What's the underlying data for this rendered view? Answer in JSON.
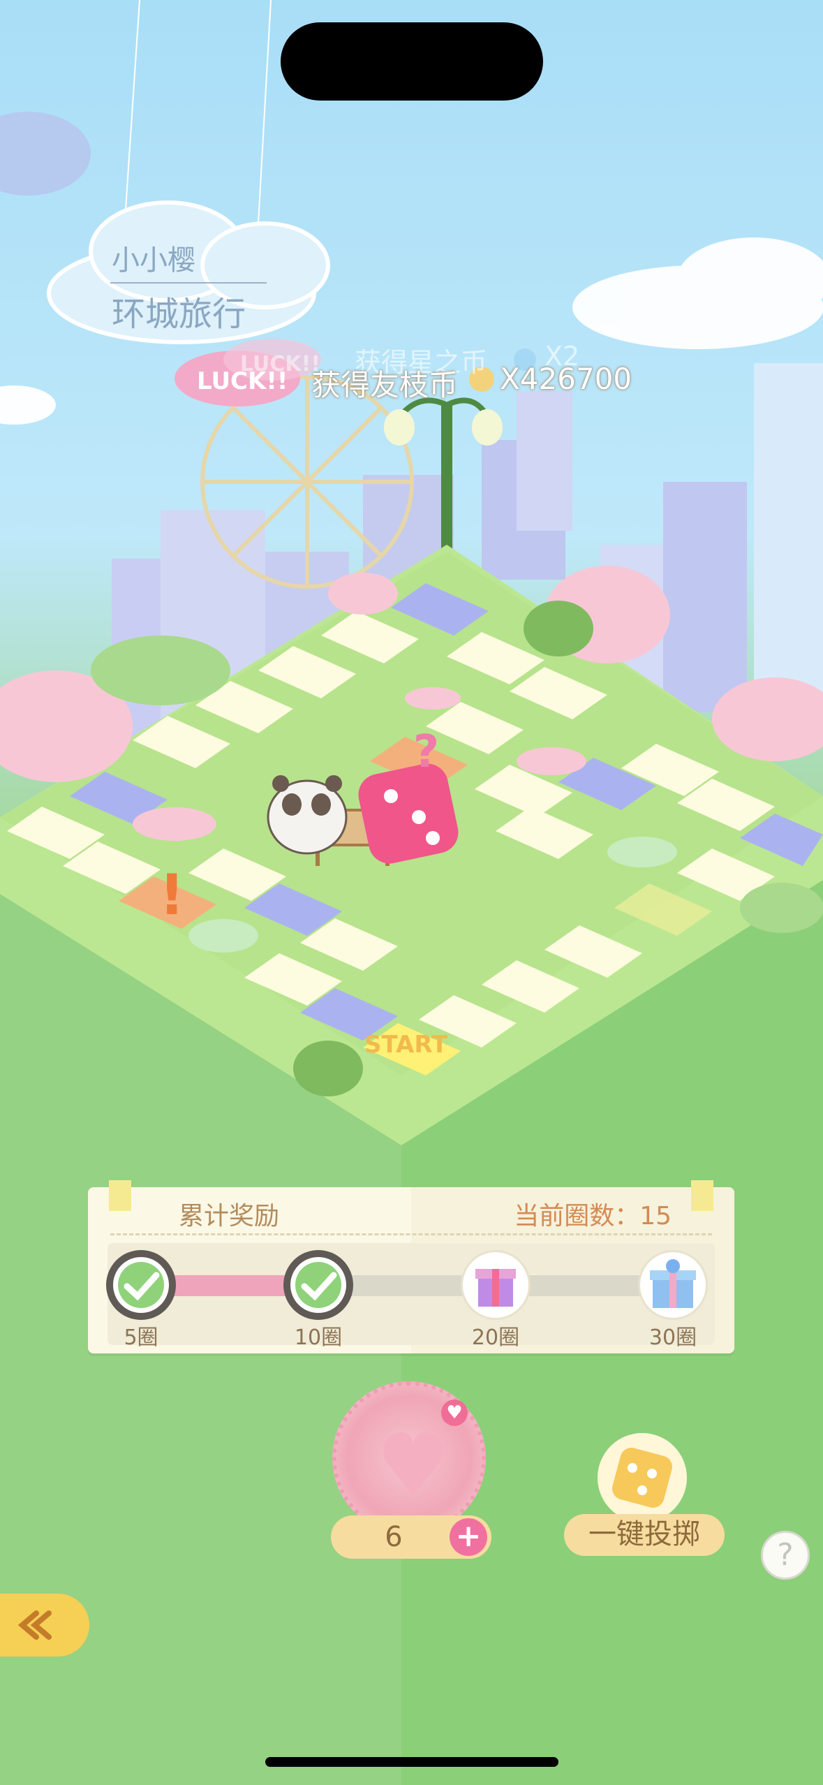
{
  "title": {
    "line1": "小小樱",
    "line2": "环城旅行"
  },
  "popups": {
    "luck_label": "LUCK!!",
    "luck_label_ghost": "LUCK!!",
    "reward_text": "获得友枝币",
    "reward_amount": "X426700",
    "ghost_reward_text": "获得星之币",
    "ghost_reward_amount": "X2"
  },
  "board": {
    "start_label": "START",
    "event_mark": "!",
    "mystery_mark": "?"
  },
  "rewards_panel": {
    "title": "累计奖励",
    "current_round_label": "当前圈数：15",
    "progress_fraction": 0.375,
    "milestones": [
      {
        "label": "5圈",
        "state": "claimed",
        "icon": "check-icon"
      },
      {
        "label": "10圈",
        "state": "claimed",
        "icon": "check-icon"
      },
      {
        "label": "20圈",
        "state": "locked",
        "icon": "gift-icon"
      },
      {
        "label": "30圈",
        "state": "locked",
        "icon": "gift-box-icon"
      }
    ]
  },
  "controls": {
    "dice_count": "6",
    "plus_label": "+",
    "auto_roll_label": "一键投掷",
    "help_label": "?"
  },
  "colors": {
    "sky": "#a9def7",
    "grass": "#9fd58c",
    "accent_pink": "#f071a0",
    "tile_cream": "#fdfbe0",
    "tile_purple": "#aab3f0",
    "tile_orange": "#f4b07c",
    "tile_yellow": "#fff176"
  }
}
